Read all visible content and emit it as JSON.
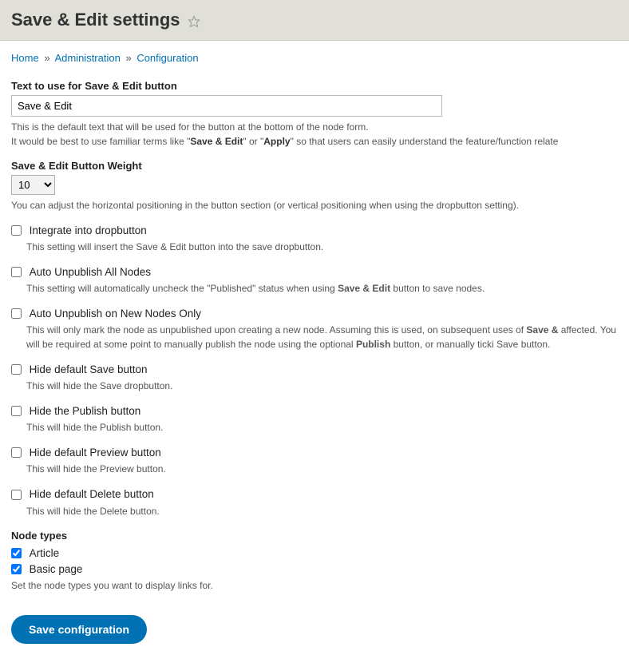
{
  "header": {
    "title": "Save & Edit settings"
  },
  "breadcrumb": {
    "home": "Home",
    "administration": "Administration",
    "configuration": "Configuration",
    "sep": "»"
  },
  "button_text": {
    "label": "Text to use for Save & Edit button",
    "value": "Save & Edit",
    "desc_line1": "This is the default text that will be used for the button at the bottom of the node form.",
    "desc_prefix": "It would be best to use familiar terms like \"",
    "desc_bold1": "Save & Edit",
    "desc_mid": "\" or \"",
    "desc_bold2": "Apply",
    "desc_suffix": "\" so that users can easily understand the feature/function relate"
  },
  "weight": {
    "label": "Save & Edit Button Weight",
    "value": "10",
    "desc": "You can adjust the horizontal positioning in the button section (or vertical positioning when using the dropbutton setting)."
  },
  "integrate": {
    "label": "Integrate into dropbutton",
    "desc": "This setting will insert the Save & Edit button into the save dropbutton."
  },
  "unpub_all": {
    "label": "Auto Unpublish All Nodes",
    "desc_prefix": "This setting will automatically uncheck the \"Published\" status when using ",
    "desc_bold": "Save & Edit",
    "desc_suffix": " button to save nodes."
  },
  "unpub_new": {
    "label": "Auto Unpublish on New Nodes Only",
    "desc_prefix": "This will only mark the node as unpublished upon creating a new node. Assuming this is used, on subsequent uses of ",
    "desc_bold1": "Save &",
    "desc_mid": " affected. You will be required at some point to manually publish the node using the optional ",
    "desc_bold2": "Publish",
    "desc_suffix": " button, or manually ticki Save button."
  },
  "hide_save": {
    "label": "Hide default Save button",
    "desc": "This will hide the Save dropbutton."
  },
  "hide_publish": {
    "label": "Hide the Publish button",
    "desc": "This will hide the Publish button."
  },
  "hide_preview": {
    "label": "Hide default Preview button",
    "desc": "This will hide the Preview button."
  },
  "hide_delete": {
    "label": "Hide default Delete button",
    "desc": "This will hide the Delete button."
  },
  "node_types": {
    "label": "Node types",
    "article": "Article",
    "basic_page": "Basic page",
    "desc": "Set the node types you want to display links for."
  },
  "submit": {
    "label": "Save configuration"
  }
}
